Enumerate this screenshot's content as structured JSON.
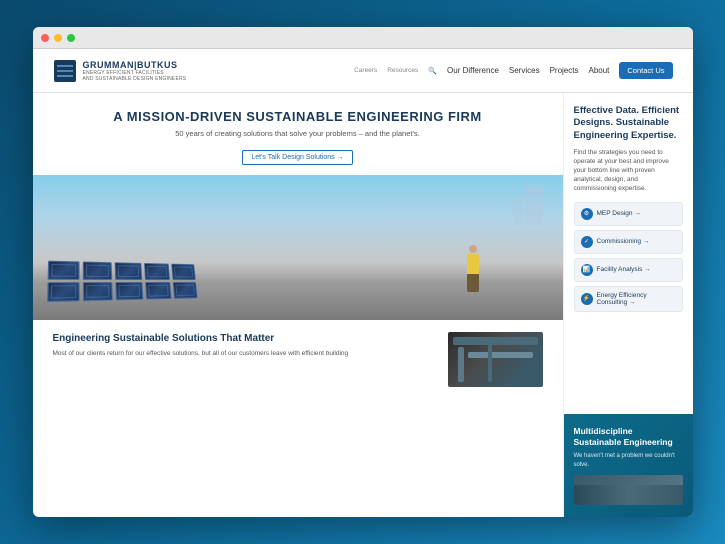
{
  "browser": {
    "dots": [
      "red",
      "yellow",
      "green"
    ]
  },
  "nav": {
    "top_links": [
      "Careers",
      "Resources"
    ],
    "logo_name": "GRUMMAN|BUTKUS",
    "logo_subtitle": "ENERGY EFFICIENT FACILITIES\nAND SUSTAINABLE DESIGN ENGINEERS",
    "links": [
      "Our Difference",
      "Services",
      "Projects",
      "About"
    ],
    "contact_btn": "Contact Us"
  },
  "hero": {
    "title": "A MISSION-DRIVEN SUSTAINABLE ENGINEERING FIRM",
    "subtitle": "50 years of creating solutions that solve your problems – and the planet's.",
    "btn_label": "Let's Talk Design Solutions →"
  },
  "bottom": {
    "title": "Engineering Sustainable Solutions That Matter",
    "text": "Most of our clients return for our effective solutions, but all of our customers leave with efficient building"
  },
  "sidebar": {
    "heading": "Effective Data. Efficient Designs. Sustainable Engineering Expertise.",
    "desc": "Find the strategies you need to operate at your best and improve your bottom line with proven analytical, design, and commissioning expertise.",
    "services": [
      {
        "label": "MEP Design →",
        "icon": "⚙"
      },
      {
        "label": "Commissioning →",
        "icon": "✓"
      },
      {
        "label": "Facility Analysis →",
        "icon": "📊"
      },
      {
        "label": "Energy Efficiency Consulting →",
        "icon": "⚡"
      }
    ],
    "bottom_title": "Multidiscipline Sustainable Engineering",
    "bottom_text": "We haven't met a problem we couldn't solve."
  }
}
